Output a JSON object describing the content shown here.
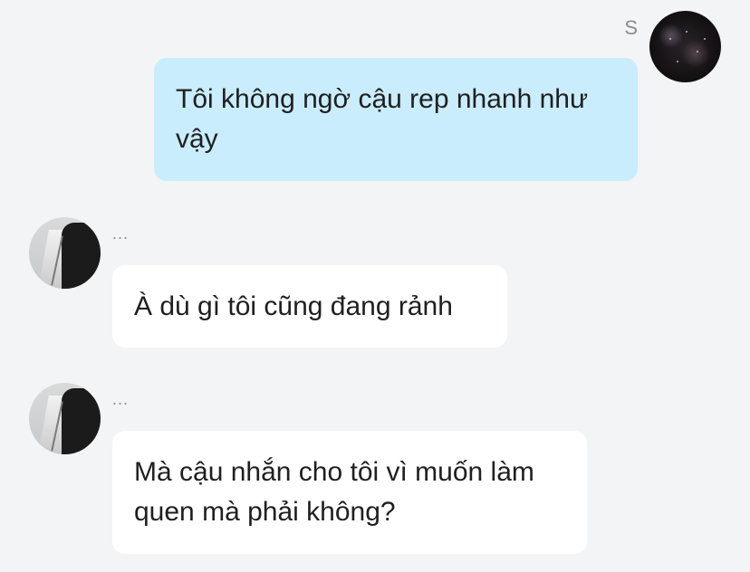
{
  "messages": [
    {
      "direction": "outgoing",
      "sender": "S",
      "text": "Tôi không ngờ cậu rep nhanh như vậy",
      "bubble_color": "#c9edfc"
    },
    {
      "direction": "incoming",
      "sender": "...",
      "text": "À dù gì tôi cũng đang rảnh",
      "bubble_color": "#ffffff"
    },
    {
      "direction": "incoming",
      "sender": "...",
      "text": "Mà cậu nhắn cho tôi vì muốn làm quen mà phải không?",
      "bubble_color": "#ffffff"
    }
  ],
  "colors": {
    "background": "#f3f4f6",
    "sender_name": "#8b8b8b"
  }
}
